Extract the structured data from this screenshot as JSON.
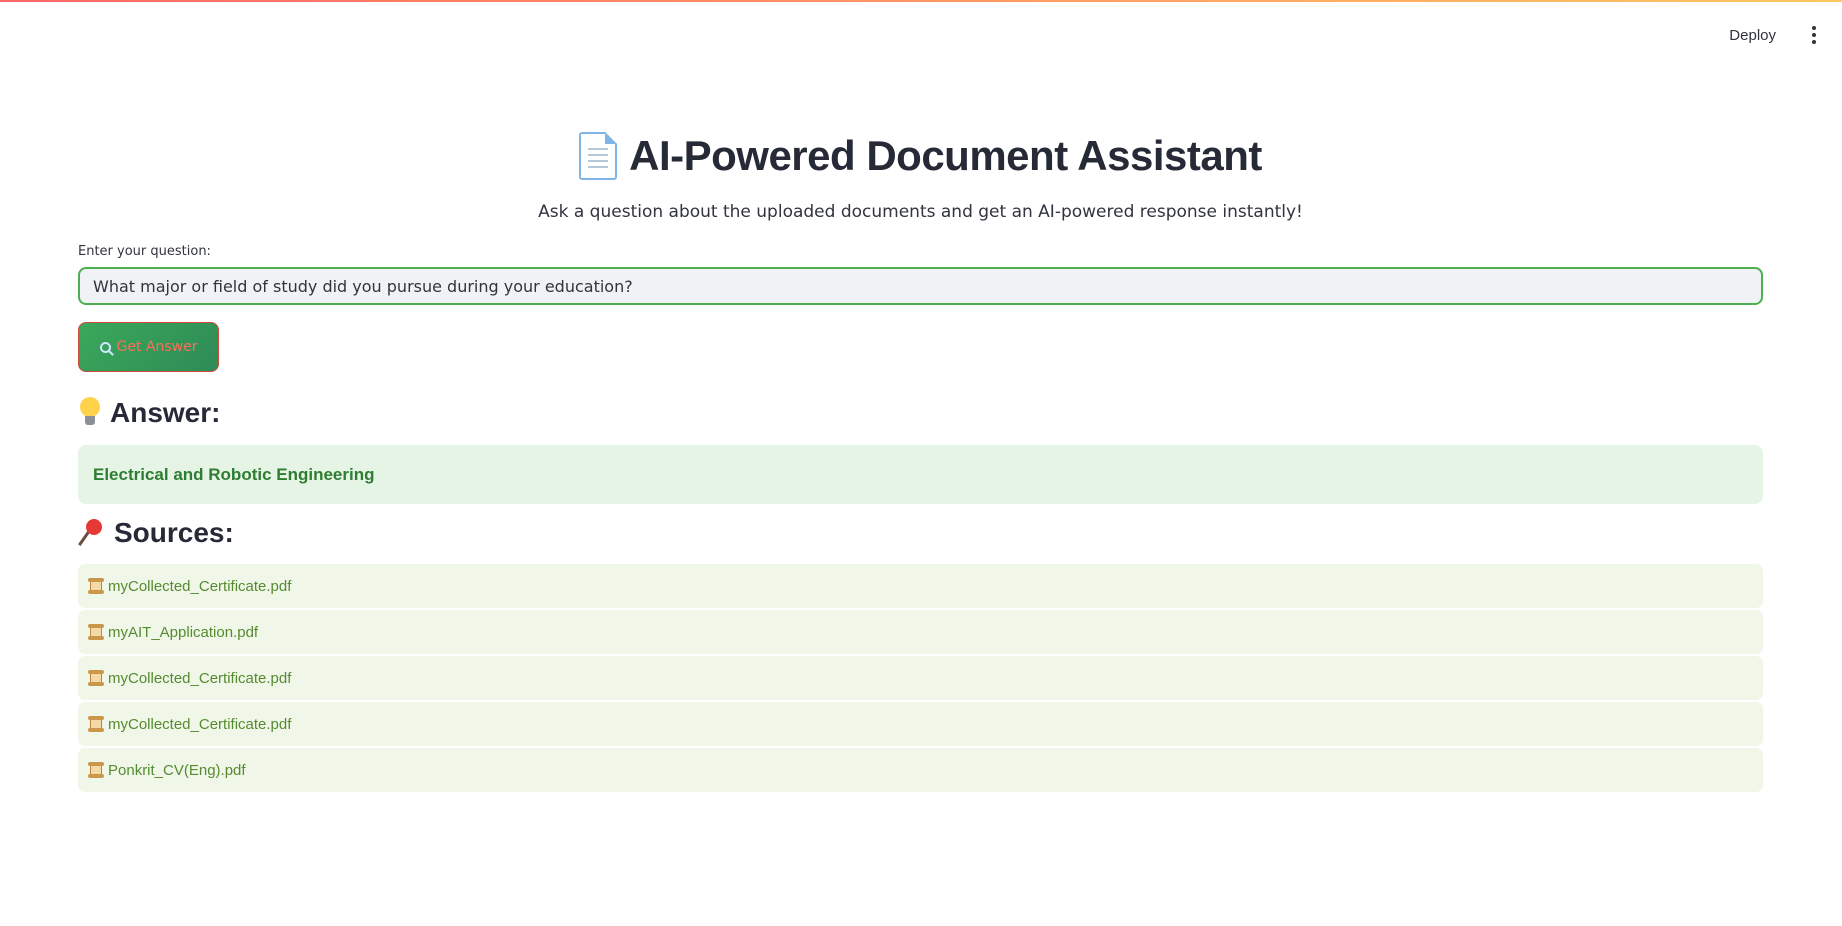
{
  "header": {
    "deploy_label": "Deploy",
    "menu_icon": "kebab-menu-icon"
  },
  "main": {
    "title_icon": "document-icon",
    "title": "AI-Powered Document Assistant",
    "subtitle": "Ask a question about the uploaded documents and get an AI-powered response instantly!",
    "question_label": "Enter your question:",
    "question_value": "What major or field of study did you pursue during your education?",
    "button": {
      "icon": "search-icon",
      "label": "Get Answer"
    },
    "answer": {
      "icon": "light-bulb-icon",
      "heading": "Answer:",
      "text": "Electrical and Robotic Engineering"
    },
    "sources": {
      "icon": "pushpin-icon",
      "heading": "Sources:",
      "item_icon": "scroll-icon",
      "items": [
        "myCollected_Certificate.pdf",
        "myAIT_Application.pdf",
        "myCollected_Certificate.pdf",
        "myCollected_Certificate.pdf",
        "Ponkrit_CV(Eng).pdf"
      ]
    }
  },
  "colors": {
    "accent_green": "#4caf50",
    "button_green": "#2e8b57",
    "answer_bg": "#e6f4e6",
    "answer_text": "#2e7d32",
    "source_bg": "#f0f7e9",
    "source_text": "#558b2f"
  }
}
